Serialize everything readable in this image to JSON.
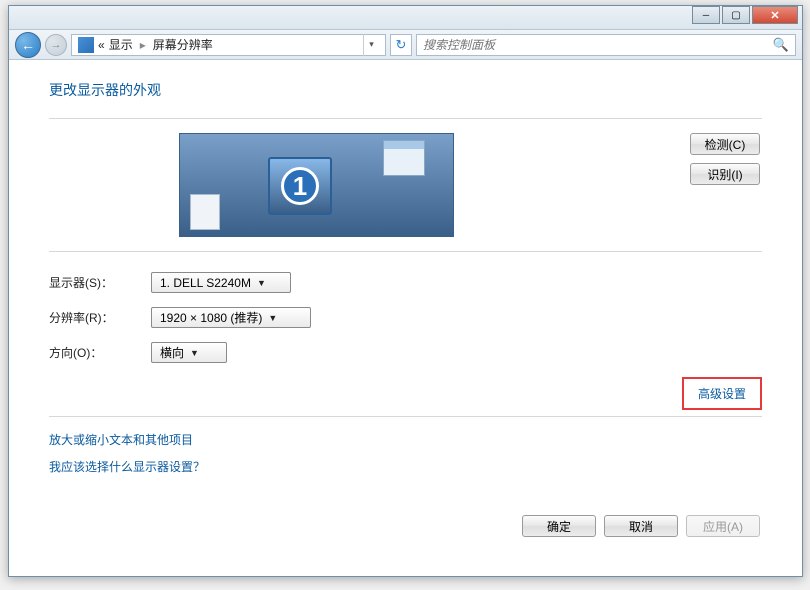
{
  "breadcrumb": {
    "prefix": "«",
    "seg1": "显示",
    "seg2": "屏幕分辨率"
  },
  "search": {
    "placeholder": "搜索控制面板"
  },
  "heading": "更改显示器的外观",
  "arrangement": {
    "detect": "检测(C)",
    "identify": "识别(I)",
    "monitor_number": "1"
  },
  "form": {
    "display_label": "显示器(S)：",
    "display_value": "1. DELL S2240M",
    "resolution_label": "分辨率(R)：",
    "resolution_value": "1920 × 1080 (推荐)",
    "orientation_label": "方向(O)：",
    "orientation_value": "横向"
  },
  "advanced_link": "高级设置",
  "links": {
    "text_size": "放大或缩小文本和其他项目",
    "which_display": "我应该选择什么显示器设置？"
  },
  "buttons": {
    "ok": "确定",
    "cancel": "取消",
    "apply": "应用(A)"
  }
}
